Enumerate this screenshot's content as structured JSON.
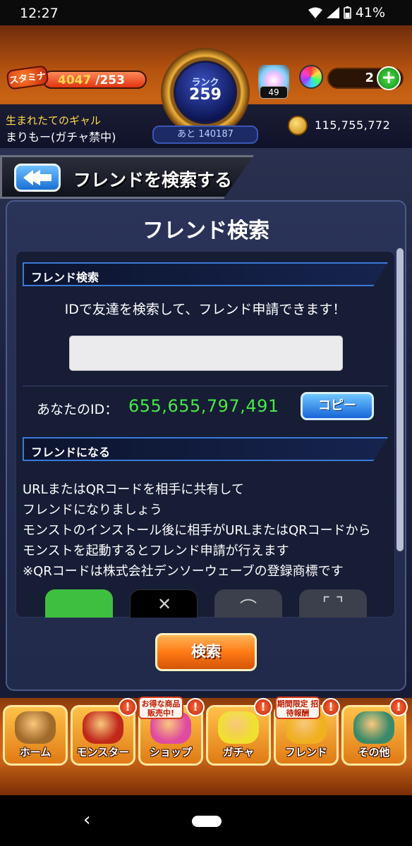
{
  "status_bar": {
    "time": "12:27",
    "battery": "41%"
  },
  "header": {
    "stamina_label": "スタミナ",
    "stamina_current": "4047",
    "stamina_max": "/253",
    "stamina_fill": 1.0,
    "rank_label": "ランク",
    "rank_value": "259",
    "rank_next": "あと 140187",
    "orb_item_count": "49",
    "orb_count": "2",
    "title": "生まれたてのギャル",
    "player_name": "まりもー(ガチャ禁中)",
    "gold": "115,755,772"
  },
  "banner": {
    "title": "フレンドを検索する"
  },
  "panel": {
    "title": "フレンド検索",
    "search_section": "フレンド検索",
    "search_desc": "IDで友達を検索して、フレンド申請できます！",
    "id_input_value": "",
    "your_id_label": "あなたのID：",
    "your_id_value": "655,655,797,491",
    "copy_label": "コピー",
    "friend_section": "フレンドになる",
    "friend_desc": [
      "URLまたはQRコードを相手に共有して",
      "フレンドになりましょう",
      "モンストのインストール後に相手がURLまたはQRコードから",
      "モンストを起動するとフレンド申請が行えます",
      "※QRコードは株式会社デンソーウェーブの登録商標です"
    ],
    "search_button": "検索"
  },
  "nav": {
    "items": [
      {
        "label": "ホーム",
        "icon": "home-gate-icon",
        "color": "#a06a2a"
      },
      {
        "label": "モンスター",
        "icon": "monster-dragon-icon",
        "color": "#c0281a"
      },
      {
        "label": "ショップ",
        "icon": "shop-orb-icon",
        "color": "#e04aa0"
      },
      {
        "label": "ガチャ",
        "icon": "gacha-egg-icon",
        "color": "#f0e030"
      },
      {
        "label": "フレンド",
        "icon": "friend-icon",
        "color": "#f0b020"
      },
      {
        "label": "その他",
        "icon": "other-menu-icon",
        "color": "#3a8a6a"
      }
    ],
    "promo_shop": "お得な商品 販売中!",
    "promo_friend": "期間限定 招待報酬"
  }
}
